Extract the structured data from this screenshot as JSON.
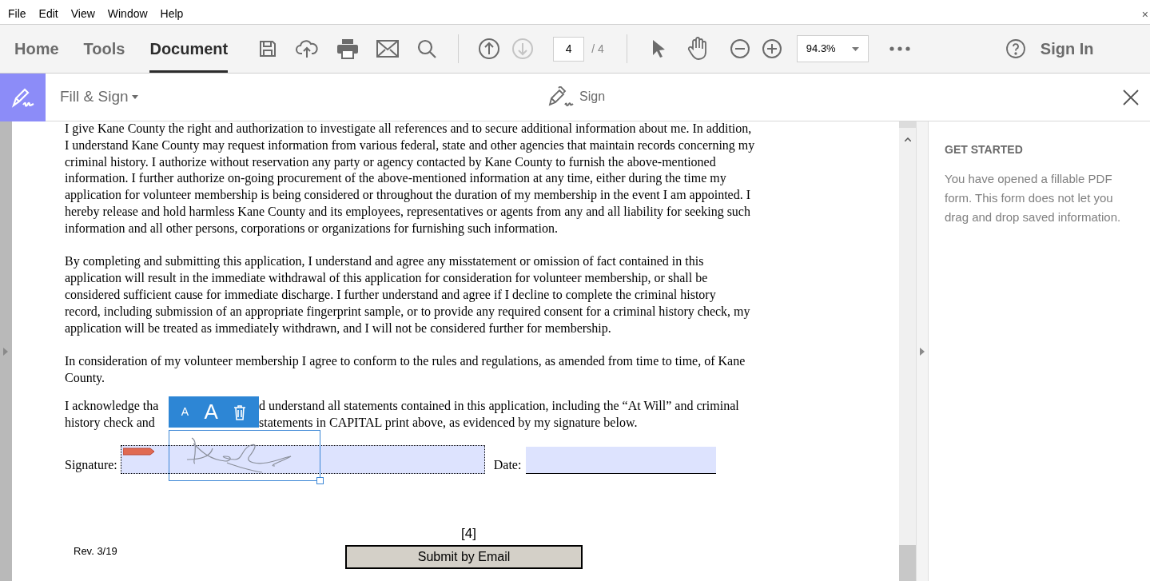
{
  "menu": [
    "File",
    "Edit",
    "View",
    "Window",
    "Help"
  ],
  "window_close": "×",
  "tabs": [
    {
      "label": "Home",
      "selected": false
    },
    {
      "label": "Tools",
      "selected": false
    },
    {
      "label": "Document",
      "selected": true
    }
  ],
  "prev_page": {
    "disabled": false
  },
  "next_page": {
    "disabled": true
  },
  "page_input": {
    "value": "4"
  },
  "page_total": "/ 4",
  "zoom": {
    "value": "94.3%"
  },
  "sign_in": "Sign In",
  "fill_sign_bar": {
    "title": "Fill & Sign",
    "sign_label": "Sign"
  },
  "document": {
    "paragraphs": [
      {
        "lines": [
          "I give Kane County the right and authorization to investigate all references and to secure additional information about me. In addition,",
          "I understand Kane County may request information from various federal, state and other agencies that maintain records concerning my",
          "criminal history. I authorize without reservation any party or agency contacted by Kane County to furnish the above-mentioned",
          "information. I further authorize on-going procurement of the above-mentioned information at any time, either during the time my",
          "application for volunteer membership is being considered or throughout the duration of my membership in the event I am appointed. I",
          "hereby release and hold harmless Kane County and its employees, representatives or agents from any and all liability for seeking such",
          "information and all other persons, corporations or organizations for furnishing such information."
        ]
      },
      {
        "lines": [
          "By completing and submitting this application, I understand and agree any misstatement or omission of fact contained in this",
          "application will result in the immediate withdrawal of this application for consideration for volunteer membership, or shall be",
          "considered sufficient cause for immediate discharge. I further understand and agree if I decline to complete the criminal history",
          "record, including submission of an appropriate fingerprint sample, or to provide any required consent for a criminal history check, my",
          "application will be treated as immediately withdrawn, and I will not be considered further for membership."
        ]
      },
      {
        "lines": [
          "In consideration of my volunteer membership I agree to conform to the rules and regulations, as amended from time to time, of Kane",
          "County."
        ]
      }
    ],
    "acknowledgement": [
      {
        "left": "I acknowledge tha",
        "right": "d understand all statements contained in this application, including the “At Will” and criminal"
      },
      {
        "left": "history check and",
        "right": "statements in CAPITAL print above, as evidenced by my signature below."
      }
    ],
    "annotation_toolbar": [
      "A",
      "A"
    ],
    "signature_label": "Signature:",
    "date_label": "Date:",
    "page_number": "[4]",
    "revision": "Rev. 3/19",
    "submit_button": "Submit by Email"
  },
  "right_panel": {
    "heading": "GET STARTED",
    "text": "You have opened a fillable PDF form. This form does not let you drag and drop saved information."
  }
}
